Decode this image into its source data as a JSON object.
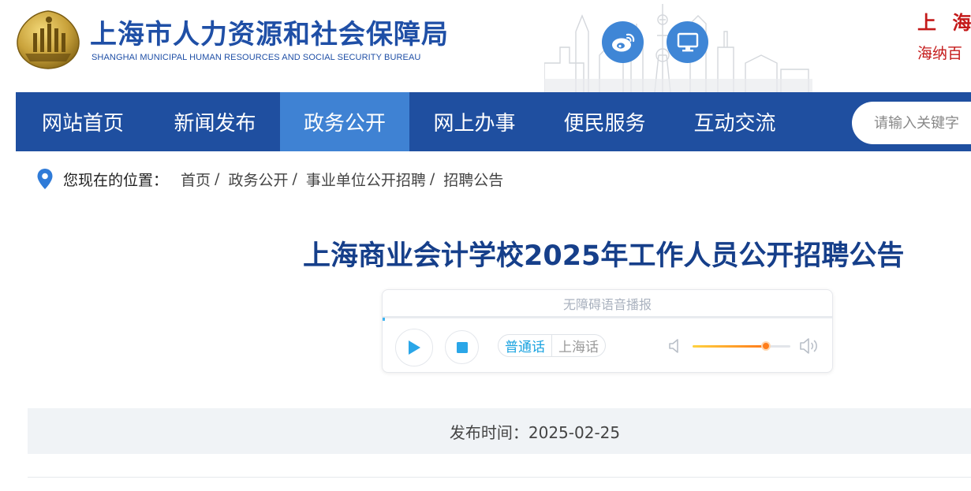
{
  "header": {
    "title": "上海市人力资源和社会保障局",
    "subtitle": "SHANGHAI MUNICIPAL HUMAN RESOURCES AND SOCIAL SECURITY BUREAU",
    "slogan_line1": "上 海 ",
    "slogan_line2": "海纳百",
    "icons": {
      "weibo": "weibo-icon",
      "desktop": "desktop-icon"
    },
    "brand_color": "#1f4fa6",
    "slogan_color": "#c41a1a"
  },
  "nav": {
    "items": [
      {
        "label": "网站首页",
        "active": false
      },
      {
        "label": "新闻发布",
        "active": false
      },
      {
        "label": "政务公开",
        "active": true
      },
      {
        "label": "网上办事",
        "active": false
      },
      {
        "label": "便民服务",
        "active": false
      },
      {
        "label": "互动交流",
        "active": false
      }
    ],
    "search": {
      "placeholder": "请输入关键字",
      "value": ""
    },
    "bg_color": "#1f4fa0",
    "active_color": "#3f82d3"
  },
  "breadcrumb": {
    "prefix": "您现在的位置：",
    "items": [
      "首页",
      "政务公开",
      "事业单位公开招聘",
      "招聘公告"
    ],
    "separator": "/"
  },
  "article": {
    "title": "上海商业会计学校2025年工作人员公开招聘公告",
    "publish_label": "发布时间：",
    "publish_date": "2025-02-25"
  },
  "player": {
    "header": "无障碍语音播报",
    "languages": [
      {
        "label": "普通话",
        "active": true
      },
      {
        "label": "上海话",
        "active": false
      }
    ],
    "volume": 0.75,
    "accent_color": "#1ba3e0",
    "volume_color": "#ff7d1a"
  }
}
